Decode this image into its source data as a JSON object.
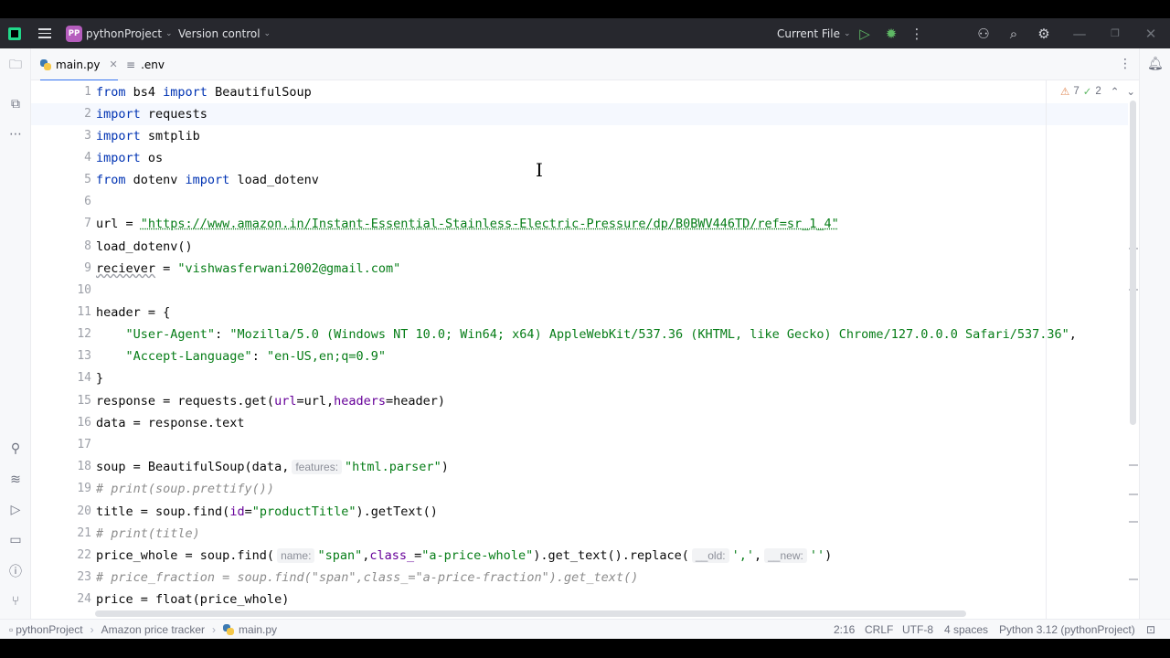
{
  "titlebar": {
    "project_badge": "PP",
    "project_name": "pythonProject",
    "vcs": "Version control",
    "run_config": "Current File"
  },
  "tabs": [
    {
      "label": "main.py",
      "active": true
    },
    {
      "label": ".env",
      "active": false
    }
  ],
  "inspections": {
    "warnings": "7",
    "ok": "2"
  },
  "line_numbers": [
    "1",
    "2",
    "3",
    "4",
    "5",
    "6",
    "7",
    "8",
    "9",
    "10",
    "11",
    "12",
    "13",
    "14",
    "15",
    "16",
    "17",
    "18",
    "19",
    "20",
    "21",
    "22",
    "23",
    "24"
  ],
  "code": {
    "l1": {
      "a": "from",
      "b": " bs4 ",
      "c": "import",
      "d": " BeautifulSoup"
    },
    "l2": {
      "a": "import",
      "b": " requests"
    },
    "l3": {
      "a": "import",
      "b": " smtplib"
    },
    "l4": {
      "a": "import",
      "b": " os"
    },
    "l5": {
      "a": "from",
      "b": " dotenv ",
      "c": "import",
      "d": " load_dotenv"
    },
    "l7": {
      "a": "url = ",
      "b": "\"https://www.amazon.in/Instant-Essential-Stainless-Electric-Pressure/dp/B0BWV446TD/ref=sr_1_4\""
    },
    "l8": {
      "a": "load_dotenv()"
    },
    "l9": {
      "a": "reciever",
      "b": " = ",
      "c": "\"vishwasferwani2002@gmail.com\""
    },
    "l11": {
      "a": "header = {"
    },
    "l12": {
      "a": "    ",
      "b": "\"User-Agent\"",
      "c": ": ",
      "d": "\"Mozilla/5.0 (Windows NT 10.0; Win64; x64) AppleWebKit/537.36 (KHTML, like Gecko) Chrome/127.0.0.0 Safari/537.36\"",
      "e": ","
    },
    "l13": {
      "a": "    ",
      "b": "\"Accept-Language\"",
      "c": ": ",
      "d": "\"en-US,en;q=0.9\""
    },
    "l14": {
      "a": "}"
    },
    "l15": {
      "a": "response = requests.get(",
      "b": "url",
      "c": "=url,",
      "d": "headers",
      "e": "=header)"
    },
    "l16": {
      "a": "data = response.text"
    },
    "l18": {
      "a": "soup = BeautifulSoup(data,",
      "hint": "features:",
      "b": "\"html.parser\"",
      "c": ")"
    },
    "l19": {
      "a": "# print(soup.prettify())"
    },
    "l20": {
      "a": "title = soup.find(",
      "b": "id",
      "c": "=",
      "d": "\"productTitle\"",
      "e": ").getText()"
    },
    "l21": {
      "a": "# print(title)"
    },
    "l22": {
      "a": "price_whole = soup.find(",
      "hint1": "name:",
      "b": "\"span\"",
      "c": ",",
      "d": "class_",
      "e": "=",
      "f": "\"a-price-whole\"",
      "g": ").get_text().replace(",
      "hint2": "__old:",
      "h": "','",
      "i": ",",
      "hint3": "__new:",
      "j": "''",
      "k": ")"
    },
    "l23": {
      "a": "# price_fraction = soup.find(\"span\",class_=\"a-price-fraction\").get_text()"
    },
    "l24": {
      "a": "price = float(price_whole)"
    }
  },
  "statusbar": {
    "crumb1": "pythonProject",
    "crumb2": "Amazon price tracker",
    "crumb3": "main.py",
    "position": "2:16",
    "line_sep": "CRLF",
    "encoding": "UTF-8",
    "indent": "4 spaces",
    "interpreter": "Python 3.12 (pythonProject)"
  }
}
